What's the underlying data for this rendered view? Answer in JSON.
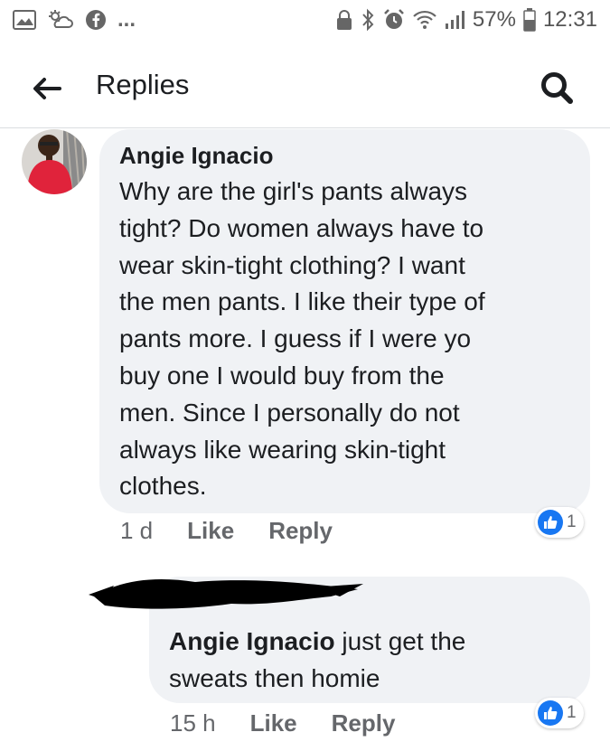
{
  "status_bar": {
    "battery_percent": "57%",
    "time": "12:31",
    "overflow": "..."
  },
  "header": {
    "title": "Replies"
  },
  "comment": {
    "author": "Angie Ignacio",
    "lines": [
      "Why are the girl's pants always",
      "tight? Do women always have to",
      "wear skin-tight clothing? I want",
      "the men pants. I like their type of",
      "pants more. I guess if I were yo",
      "buy one I would buy from the",
      "men. Since I personally do not",
      "always like wearing skin-tight",
      "clothes."
    ],
    "time": "1 d",
    "like_label": "Like",
    "reply_label": "Reply",
    "reaction_count": "1"
  },
  "reply": {
    "mention": "Angie Ignacio",
    "text_first": " just get the",
    "text_second": "sweats then homie",
    "time": "15 h",
    "like_label": "Like",
    "reply_label": "Reply",
    "reaction_count": "1"
  },
  "colors": {
    "bubble": "#f0f2f5",
    "meta_text": "#65676b",
    "like_blue": "#1877f2",
    "avatar_shirt": "#e0233b"
  }
}
